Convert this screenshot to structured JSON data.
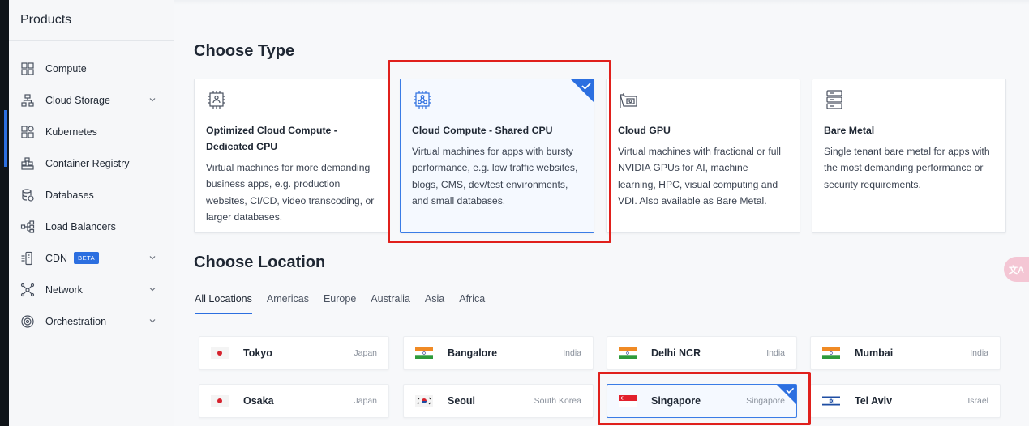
{
  "sidebar": {
    "title": "Products",
    "items": [
      {
        "label": "Compute",
        "icon": "compute-icon",
        "chevron": false
      },
      {
        "label": "Cloud Storage",
        "icon": "cloud-storage-icon",
        "chevron": true
      },
      {
        "label": "Kubernetes",
        "icon": "kubernetes-icon",
        "chevron": false
      },
      {
        "label": "Container Registry",
        "icon": "container-registry-icon",
        "chevron": false
      },
      {
        "label": "Databases",
        "icon": "database-icon",
        "chevron": false
      },
      {
        "label": "Load Balancers",
        "icon": "load-balancer-icon",
        "chevron": false
      },
      {
        "label": "CDN",
        "icon": "cdn-icon",
        "chevron": true,
        "badge": "BETA"
      },
      {
        "label": "Network",
        "icon": "network-icon",
        "chevron": true
      },
      {
        "label": "Orchestration",
        "icon": "orchestration-icon",
        "chevron": true
      }
    ]
  },
  "type_section": {
    "title": "Choose Type",
    "cards": [
      {
        "title": "Optimized Cloud Compute - Dedicated CPU",
        "desc": "Virtual machines for more demanding business apps, e.g. production websites, CI/CD, video transcoding, or larger databases.",
        "icon": "cpu-icon",
        "selected": false
      },
      {
        "title": "Cloud Compute - Shared CPU",
        "desc": "Virtual machines for apps with bursty performance, e.g. low traffic websites, blogs, CMS, dev/test environments, and small databases.",
        "icon": "shared-cpu-icon",
        "selected": true
      },
      {
        "title": "Cloud GPU",
        "desc": "Virtual machines with fractional or full NVIDIA GPUs for AI, machine learning, HPC, visual computing and VDI. Also available as Bare Metal.",
        "icon": "gpu-icon",
        "selected": false
      },
      {
        "title": "Bare Metal",
        "desc": "Single tenant bare metal for apps with the most demanding performance or security requirements.",
        "icon": "server-icon",
        "selected": false
      }
    ]
  },
  "location_section": {
    "title": "Choose Location",
    "tabs": [
      "All Locations",
      "Americas",
      "Europe",
      "Australia",
      "Asia",
      "Africa"
    ],
    "active_tab": "All Locations",
    "locations": [
      {
        "city": "Tokyo",
        "country": "Japan",
        "flag": "japan-flag-icon",
        "selected": false
      },
      {
        "city": "Bangalore",
        "country": "India",
        "flag": "india-flag-icon",
        "selected": false
      },
      {
        "city": "Delhi NCR",
        "country": "India",
        "flag": "india-flag-icon",
        "selected": false
      },
      {
        "city": "Mumbai",
        "country": "India",
        "flag": "india-flag-icon",
        "selected": false
      },
      {
        "city": "Osaka",
        "country": "Japan",
        "flag": "japan-flag-icon",
        "selected": false
      },
      {
        "city": "Seoul",
        "country": "South Korea",
        "flag": "south-korea-flag-icon",
        "selected": false
      },
      {
        "city": "Singapore",
        "country": "Singapore",
        "flag": "singapore-flag-icon",
        "selected": true
      },
      {
        "city": "Tel Aviv",
        "country": "Israel",
        "flag": "israel-flag-icon",
        "selected": false
      }
    ]
  },
  "floating_button": {
    "label": "文A",
    "icon": "translate-icon"
  },
  "colors": {
    "accent": "#2c6fe0",
    "highlight": "#e0201c",
    "selected_bg": "#f5f9ff"
  }
}
